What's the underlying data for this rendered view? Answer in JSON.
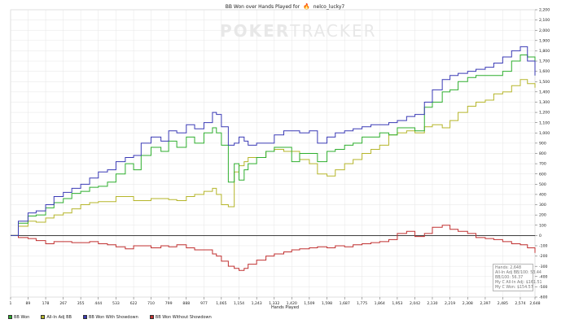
{
  "window": {
    "title_prefix": "BB Won over Hands Played for",
    "player": "nelco_lucky7",
    "flame_icon": "flame-icon",
    "watermark_bold": "POKER",
    "watermark_tail": "TRACKER"
  },
  "stats": {
    "hands": "Hands: 2,648",
    "allin_bb100": "All-In Adj BB/100: 53.44",
    "bb100": "BB/100: 56.37",
    "allin_won": "My C All-In Adj: $161.51",
    "won": "My C Won: $154.57"
  },
  "colors": {
    "bb_won": "#2eae2e",
    "allin_adj": "#b5b52a",
    "showdown": "#3a3ab5",
    "non_showdown": "#c03030",
    "zero_line": "#000000",
    "grid": "#e6e6e6"
  },
  "chart_data": {
    "type": "line",
    "title": "BB Won over Hands Played for nelco_lucky7",
    "xlabel": "Hands Played",
    "ylabel": "",
    "xlim": [
      1,
      2648
    ],
    "ylim": [
      -600,
      2200
    ],
    "x_ticks": [
      "1",
      "89",
      "178",
      "267",
      "355",
      "444",
      "533",
      "622",
      "710",
      "799",
      "888",
      "977",
      "1,065",
      "1,154",
      "1,243",
      "1,332",
      "1,420",
      "1,509",
      "1,598",
      "1,687",
      "1,775",
      "1,864",
      "1,953",
      "2,042",
      "2,130",
      "2,219",
      "2,308",
      "2,397",
      "2,485",
      "2,574",
      "2,648"
    ],
    "x_tick_values": [
      1,
      89,
      178,
      267,
      355,
      444,
      533,
      622,
      710,
      799,
      888,
      977,
      1065,
      1154,
      1243,
      1332,
      1420,
      1509,
      1598,
      1687,
      1775,
      1864,
      1953,
      2042,
      2130,
      2219,
      2308,
      2397,
      2485,
      2574,
      2648
    ],
    "y_ticks": [
      -600,
      -500,
      -400,
      -300,
      -200,
      -100,
      0,
      100,
      200,
      300,
      400,
      500,
      600,
      700,
      800,
      900,
      1000,
      1100,
      1200,
      1300,
      1400,
      1500,
      1600,
      1700,
      1800,
      1900,
      2000,
      2100,
      2200
    ],
    "y_tick_labels": [
      "-600",
      "-500",
      "-400",
      "-300",
      "-200",
      "-100",
      "0",
      "100",
      "200",
      "300",
      "400",
      "500",
      "600",
      "700",
      "800",
      "900",
      "1,000",
      "1,100",
      "1,200",
      "1,300",
      "1,400",
      "1,500",
      "1,600",
      "1,700",
      "1,800",
      "1,900",
      "2,000",
      "2,100",
      "2,200"
    ],
    "grid": true,
    "legend_position": "bottom-left",
    "x": [
      1,
      40,
      89,
      130,
      178,
      220,
      267,
      310,
      355,
      400,
      444,
      490,
      533,
      580,
      622,
      660,
      710,
      760,
      799,
      840,
      888,
      930,
      977,
      1020,
      1040,
      1065,
      1100,
      1130,
      1154,
      1180,
      1200,
      1243,
      1290,
      1332,
      1380,
      1420,
      1460,
      1509,
      1550,
      1598,
      1640,
      1687,
      1730,
      1775,
      1820,
      1864,
      1910,
      1953,
      2000,
      2042,
      2090,
      2130,
      2180,
      2219,
      2260,
      2308,
      2350,
      2397,
      2440,
      2485,
      2530,
      2574,
      2610,
      2648
    ],
    "series": [
      {
        "name": "BB Won",
        "values": [
          0,
          120,
          190,
          200,
          270,
          320,
          360,
          410,
          430,
          470,
          480,
          520,
          600,
          700,
          640,
          780,
          860,
          820,
          920,
          860,
          960,
          900,
          1000,
          1050,
          1000,
          880,
          520,
          700,
          540,
          640,
          700,
          760,
          820,
          860,
          860,
          720,
          800,
          800,
          720,
          820,
          840,
          880,
          900,
          960,
          960,
          1000,
          980,
          1050,
          1050,
          1020,
          1250,
          1300,
          1400,
          1420,
          1500,
          1540,
          1560,
          1560,
          1560,
          1600,
          1700,
          1760,
          1740,
          1560
        ]
      },
      {
        "name": "All-In Adj BB",
        "values": [
          0,
          90,
          140,
          130,
          170,
          200,
          220,
          260,
          300,
          320,
          330,
          330,
          380,
          380,
          340,
          340,
          360,
          360,
          350,
          340,
          380,
          400,
          430,
          460,
          400,
          300,
          280,
          620,
          680,
          720,
          760,
          760,
          820,
          840,
          820,
          820,
          740,
          700,
          600,
          580,
          640,
          700,
          740,
          800,
          840,
          880,
          980,
          1000,
          1020,
          1000,
          1060,
          1080,
          1050,
          1120,
          1200,
          1260,
          1300,
          1320,
          1380,
          1400,
          1460,
          1520,
          1480,
          1440
        ]
      },
      {
        "name": "BB Won With Showdown",
        "values": [
          0,
          140,
          220,
          240,
          300,
          380,
          420,
          460,
          500,
          560,
          620,
          640,
          720,
          760,
          780,
          900,
          960,
          920,
          1020,
          1000,
          1080,
          1040,
          1100,
          1200,
          1180,
          1060,
          880,
          900,
          960,
          920,
          880,
          900,
          900,
          980,
          1020,
          1020,
          1000,
          1020,
          900,
          960,
          1000,
          1020,
          1040,
          1060,
          1080,
          1080,
          1100,
          1120,
          1160,
          1180,
          1300,
          1420,
          1520,
          1560,
          1580,
          1600,
          1620,
          1640,
          1680,
          1740,
          1800,
          1840,
          1700,
          1560
        ]
      },
      {
        "name": "BB Won Without Showdown",
        "values": [
          0,
          -20,
          -30,
          -50,
          -80,
          -60,
          -60,
          -70,
          -70,
          -60,
          -80,
          -90,
          -110,
          -130,
          -100,
          -100,
          -120,
          -100,
          -110,
          -90,
          -120,
          -140,
          -140,
          -180,
          -200,
          -250,
          -300,
          -320,
          -340,
          -320,
          -280,
          -240,
          -200,
          -180,
          -160,
          -140,
          -130,
          -120,
          -110,
          -120,
          -100,
          -110,
          -90,
          -80,
          -70,
          -60,
          -40,
          20,
          40,
          -10,
          20,
          80,
          100,
          60,
          40,
          20,
          -20,
          -30,
          -40,
          -60,
          -80,
          -90,
          -120,
          -170
        ]
      }
    ]
  },
  "legend": {
    "items": [
      {
        "label": "BB Won",
        "icon": "legend-bb-won-swatch"
      },
      {
        "label": "All-In Adj BB",
        "icon": "legend-allin-swatch"
      },
      {
        "label": "BB Won With Showdown",
        "icon": "legend-showdown-swatch"
      },
      {
        "label": "BB Won Without Showdown",
        "icon": "legend-non-showdown-swatch"
      }
    ]
  }
}
